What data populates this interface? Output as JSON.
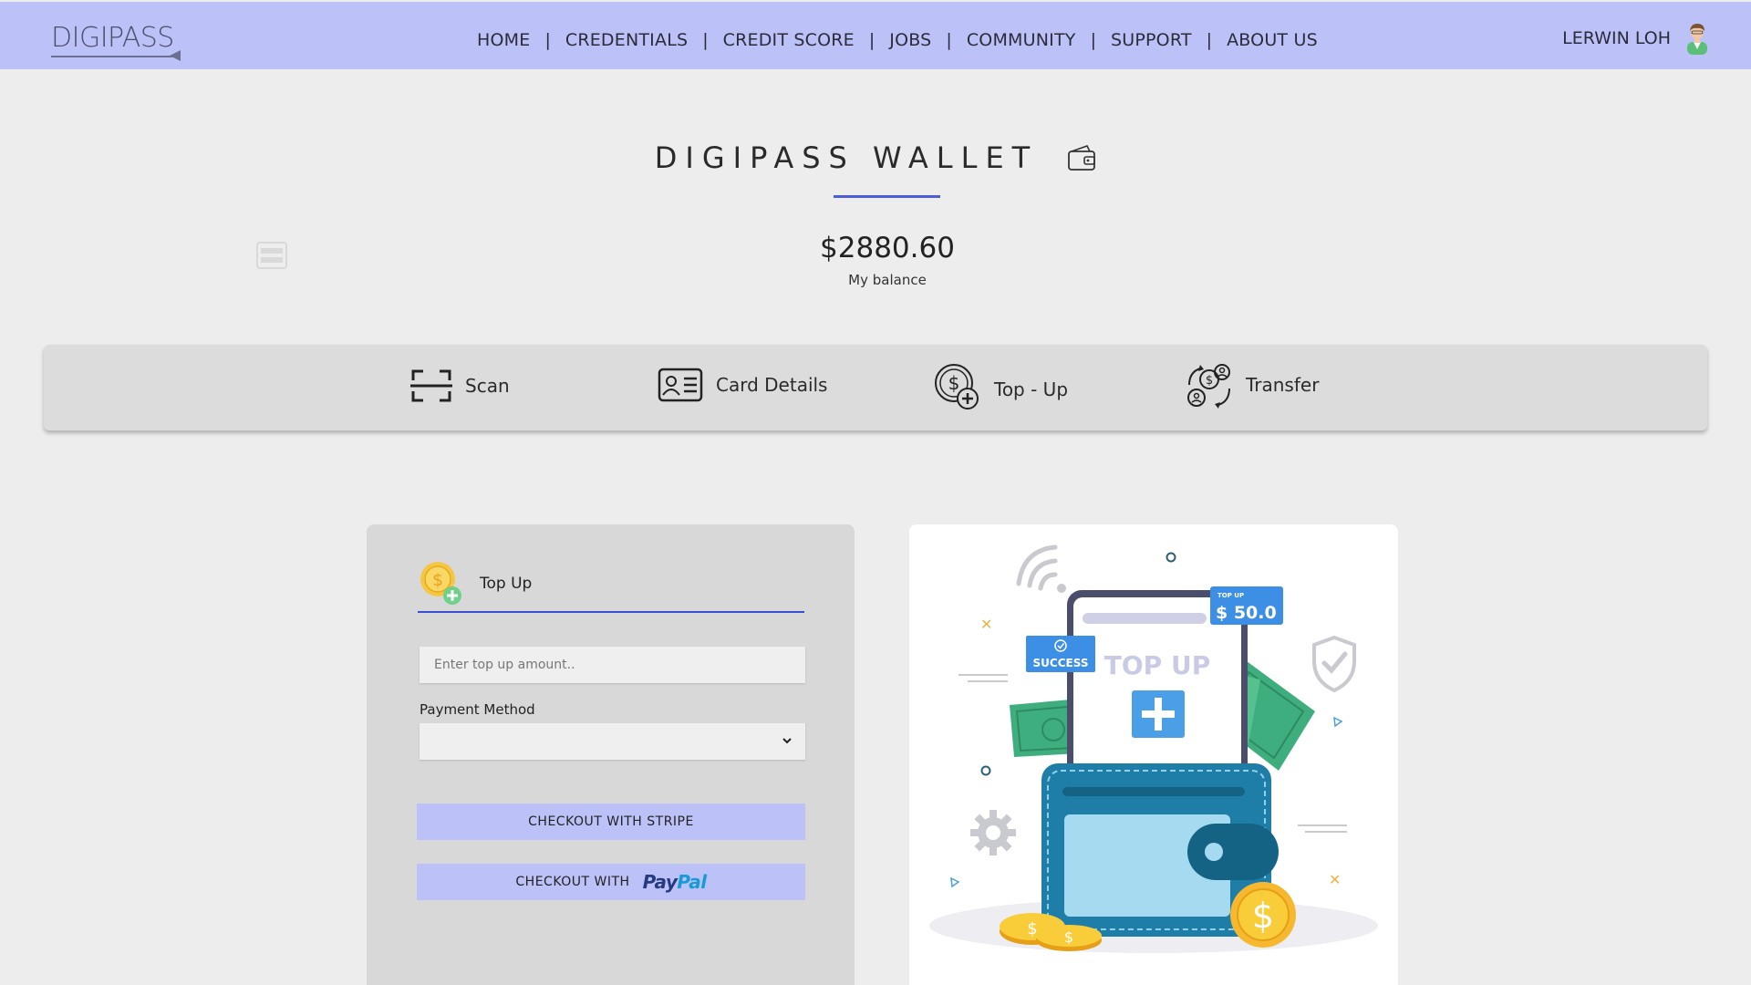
{
  "nav": {
    "logo": "DIGIPASS",
    "links": [
      "HOME",
      "CREDENTIALS",
      "CREDIT SCORE",
      "JOBS",
      "COMMUNITY",
      "SUPPORT",
      "ABOUT US"
    ],
    "separator": "|",
    "user_name": "LERWIN LOH"
  },
  "wallet": {
    "title": "DIGIPASS WALLET",
    "balance": "$2880.60",
    "balance_label": "My balance"
  },
  "actions": [
    {
      "label": "Scan",
      "icon": "scan-icon"
    },
    {
      "label": "Card Details",
      "icon": "id-card-icon"
    },
    {
      "label": "Top - Up",
      "icon": "coin-plus-icon"
    },
    {
      "label": "Transfer",
      "icon": "transfer-icon"
    }
  ],
  "topup": {
    "heading": "Top Up",
    "amount_placeholder": "Enter top up amount..",
    "payment_method_label": "Payment Method",
    "payment_method_value": "",
    "stripe_button": "CHECKOUT WITH STRIPE",
    "paypal_button_prefix": "CHECKOUT WITH",
    "paypal_pay": "Pay",
    "paypal_pal": "Pal"
  },
  "illustration": {
    "badge_small": "TOP UP",
    "badge_amount": "$ 50.0",
    "success_text": "SUCCESS",
    "screen_title": "TOP UP",
    "coin_symbol": "$"
  },
  "colors": {
    "nav_bg": "#bcc2f8",
    "accent": "#4c5fd6",
    "button_bg": "#bcc2f8",
    "page_bg": "#ededed",
    "card_bg": "#d8d8d8"
  }
}
